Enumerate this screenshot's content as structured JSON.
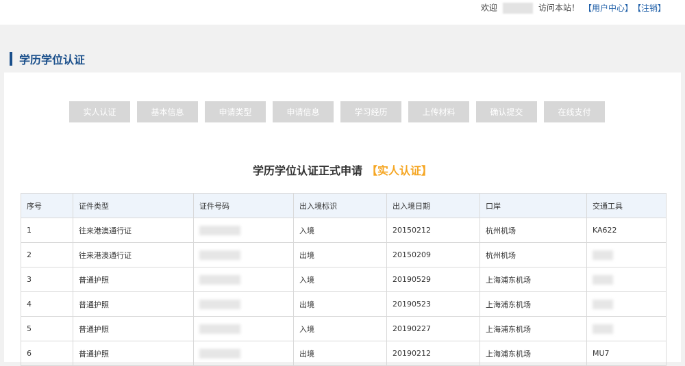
{
  "topbar": {
    "welcome": "欢迎",
    "visit_text": "访问本站！",
    "user_center": "【用户中心】",
    "logout": "【注销】"
  },
  "section": {
    "title": "学历学位认证"
  },
  "steps": [
    "实人认证",
    "基本信息",
    "申请类型",
    "申请信息",
    "学习经历",
    "上传材料",
    "确认提交",
    "在线支付"
  ],
  "form": {
    "title": "学历学位认证正式申请",
    "status": "【实人认证】"
  },
  "table": {
    "headers": [
      "序号",
      "证件类型",
      "证件号码",
      "出入境标识",
      "出入境日期",
      "口岸",
      "交通工具"
    ],
    "rows": [
      {
        "no": "1",
        "doc_type": "往来港澳通行证",
        "direction": "入境",
        "date": "20150212",
        "port": "杭州机场",
        "transport": "KA622"
      },
      {
        "no": "2",
        "doc_type": "往来港澳通行证",
        "direction": "出境",
        "date": "20150209",
        "port": "杭州机场",
        "transport": ""
      },
      {
        "no": "3",
        "doc_type": "普通护照",
        "direction": "入境",
        "date": "20190529",
        "port": "上海浦东机场",
        "transport": ""
      },
      {
        "no": "4",
        "doc_type": "普通护照",
        "direction": "出境",
        "date": "20190523",
        "port": "上海浦东机场",
        "transport": ""
      },
      {
        "no": "5",
        "doc_type": "普通护照",
        "direction": "入境",
        "date": "20190227",
        "port": "上海浦东机场",
        "transport": ""
      },
      {
        "no": "6",
        "doc_type": "普通护照",
        "direction": "出境",
        "date": "20190212",
        "port": "上海浦东机场",
        "transport": "MU7"
      }
    ]
  }
}
